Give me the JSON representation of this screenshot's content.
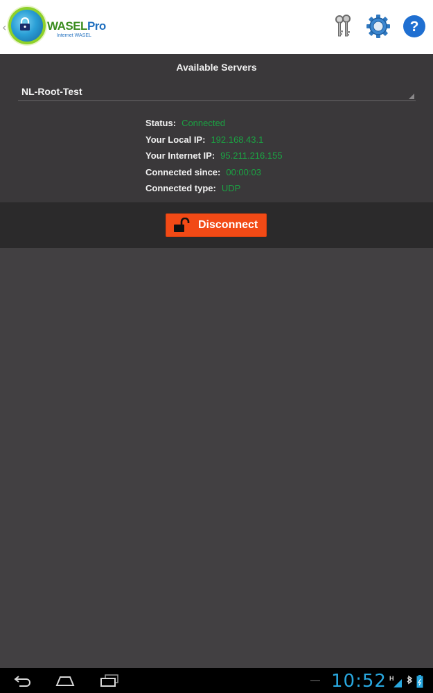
{
  "app": {
    "logo_word_1": "WASEL",
    "logo_word_2": "Pro",
    "logo_sub": "Internet WASEL",
    "actions": [
      {
        "name": "keys-icon"
      },
      {
        "name": "settings-icon"
      },
      {
        "name": "help-icon"
      }
    ]
  },
  "servers": {
    "title": "Available Servers",
    "selected": "NL-Root-Test"
  },
  "info": [
    {
      "label": "Status:",
      "value": "Connected"
    },
    {
      "label": "Your Local IP:",
      "value": "192.168.43.1"
    },
    {
      "label": "Your Internet IP:",
      "value": "95.211.216.155"
    },
    {
      "label": "Connected since:",
      "value": "00:00:03"
    },
    {
      "label": "Connected type:",
      "value": "UDP"
    }
  ],
  "button": {
    "label": "Disconnect",
    "icon": "unlock-icon"
  },
  "system": {
    "time": "10:52",
    "signal_label": "H"
  },
  "colors": {
    "accent": "#f24a16",
    "status_value": "#1ba343",
    "clock": "#29a8e0"
  }
}
